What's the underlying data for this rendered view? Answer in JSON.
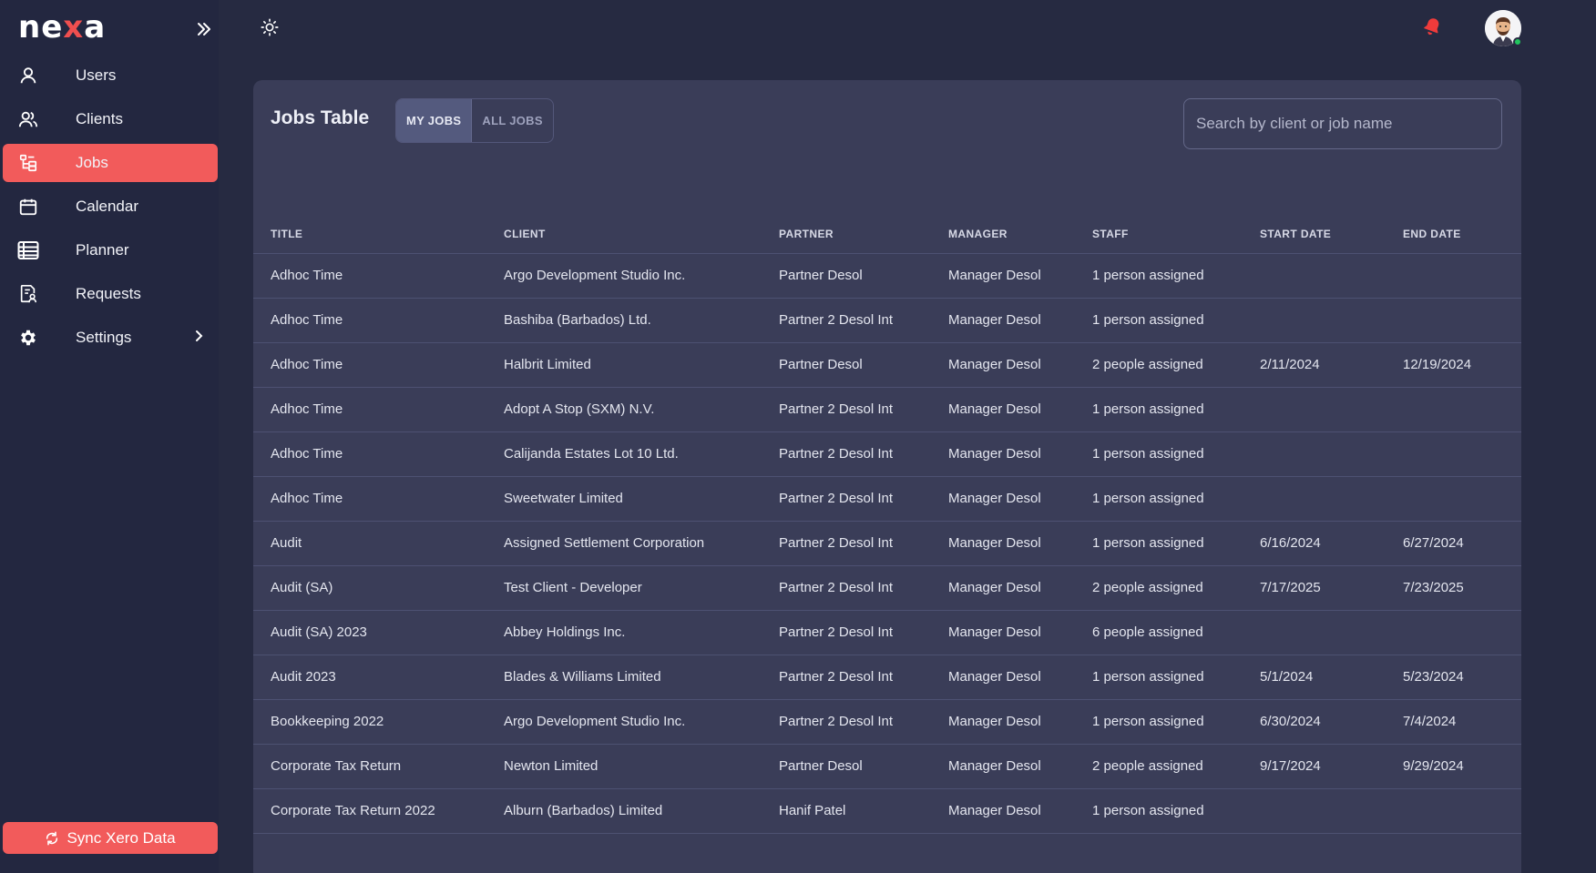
{
  "brand": {
    "logo_pre": "ne",
    "logo_x": "x",
    "logo_post": "a"
  },
  "sidebar": {
    "items": [
      {
        "label": "Users",
        "icon": "user-icon"
      },
      {
        "label": "Clients",
        "icon": "users-icon"
      },
      {
        "label": "Jobs",
        "icon": "jobs-icon",
        "active": true
      },
      {
        "label": "Calendar",
        "icon": "calendar-icon"
      },
      {
        "label": "Planner",
        "icon": "table-icon"
      },
      {
        "label": "Requests",
        "icon": "request-icon"
      },
      {
        "label": "Settings",
        "icon": "gear-icon"
      }
    ],
    "sync_label": "Sync Xero Data"
  },
  "colors": {
    "accent": "#f25b5b",
    "background": "#262a41",
    "card": "#3a3d58",
    "online": "#22c55e"
  },
  "jobs": {
    "title": "Jobs Table",
    "tabs": [
      "MY JOBS",
      "ALL JOBS"
    ],
    "selected_tab": "MY JOBS",
    "search_placeholder": "Search by client or job name",
    "columns": [
      "TITLE",
      "CLIENT",
      "PARTNER",
      "MANAGER",
      "STAFF",
      "START DATE",
      "END DATE"
    ],
    "rows": [
      [
        "Adhoc Time",
        "Argo Development Studio Inc.",
        "Partner Desol",
        "Manager Desol",
        "1 person assigned",
        "",
        ""
      ],
      [
        "Adhoc Time",
        "Bashiba (Barbados) Ltd.",
        "Partner 2 Desol Int",
        "Manager Desol",
        "1 person assigned",
        "",
        ""
      ],
      [
        "Adhoc Time",
        "Halbrit Limited",
        "Partner Desol",
        "Manager Desol",
        "2 people assigned",
        "2/11/2024",
        "12/19/2024"
      ],
      [
        "Adhoc Time",
        "Adopt A Stop (SXM) N.V.",
        "Partner 2 Desol Int",
        "Manager Desol",
        "1 person assigned",
        "",
        ""
      ],
      [
        "Adhoc Time",
        "Calijanda Estates Lot 10 Ltd.",
        "Partner 2 Desol Int",
        "Manager Desol",
        "1 person assigned",
        "",
        ""
      ],
      [
        "Adhoc Time",
        "Sweetwater Limited",
        "Partner 2 Desol Int",
        "Manager Desol",
        "1 person assigned",
        "",
        ""
      ],
      [
        "Audit",
        "Assigned Settlement Corporation",
        "Partner 2 Desol Int",
        "Manager Desol",
        "1 person assigned",
        "6/16/2024",
        "6/27/2024"
      ],
      [
        "Audit (SA)",
        "Test Client - Developer",
        "Partner 2 Desol Int",
        "Manager Desol",
        "2 people assigned",
        "7/17/2025",
        "7/23/2025"
      ],
      [
        "Audit (SA) 2023",
        "Abbey Holdings Inc.",
        "Partner 2 Desol Int",
        "Manager Desol",
        "6 people assigned",
        "",
        ""
      ],
      [
        "Audit 2023",
        "Blades & Williams Limited",
        "Partner 2 Desol Int",
        "Manager Desol",
        "1 person assigned",
        "5/1/2024",
        "5/23/2024"
      ],
      [
        "Bookkeeping 2022",
        "Argo Development Studio Inc.",
        "Partner 2 Desol Int",
        "Manager Desol",
        "1 person assigned",
        "6/30/2024",
        "7/4/2024"
      ],
      [
        "Corporate Tax Return",
        "Newton Limited",
        "Partner Desol",
        "Manager Desol",
        "2 people assigned",
        "9/17/2024",
        "9/29/2024"
      ],
      [
        "Corporate Tax Return 2022",
        "Alburn (Barbados) Limited",
        "Hanif Patel",
        "Manager Desol",
        "1 person assigned",
        "",
        ""
      ]
    ]
  }
}
